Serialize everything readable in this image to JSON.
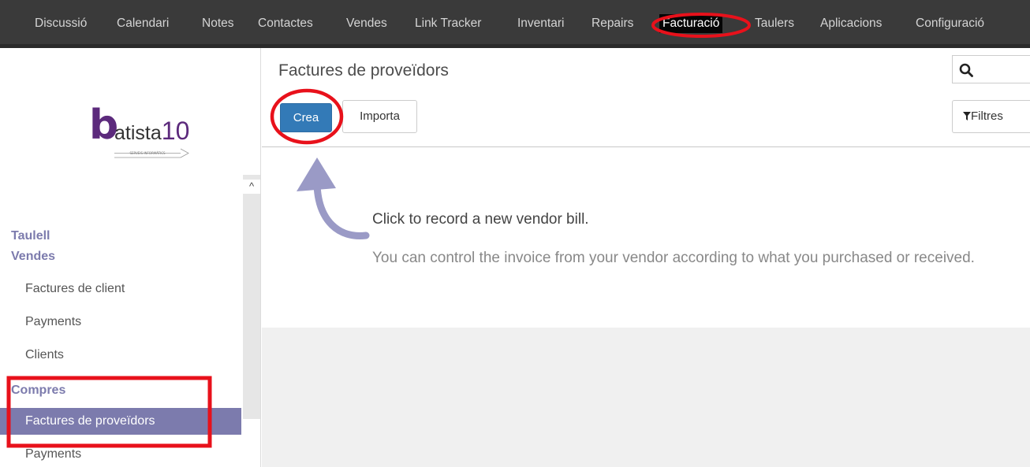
{
  "topbar": {
    "menu": [
      {
        "label": "Discussió"
      },
      {
        "label": "Calendari"
      },
      {
        "label": "Notes"
      },
      {
        "label": "Contactes"
      },
      {
        "label": "Vendes"
      },
      {
        "label": "Link Tracker"
      },
      {
        "label": "Inventari"
      },
      {
        "label": "Repairs"
      },
      {
        "label": "Facturació",
        "active": true
      },
      {
        "label": "Taulers"
      },
      {
        "label": "Aplicacions"
      },
      {
        "label": "Configuració"
      }
    ]
  },
  "logo": {
    "initial": "b",
    "name": "atista",
    "suffix": "10",
    "tagline": "SERVEIS INFORMÀTICS"
  },
  "sidebar": {
    "heading_dashboard": "Taulell",
    "heading_sales": "Vendes",
    "sales_items": [
      {
        "label": "Factures de client"
      },
      {
        "label": "Payments"
      },
      {
        "label": "Clients"
      }
    ],
    "heading_purchases": "Compres",
    "purchase_items": [
      {
        "label": "Factures de proveïdors",
        "active": true
      },
      {
        "label": "Payments"
      }
    ],
    "scroll_up": "^"
  },
  "main": {
    "title": "Factures de proveïdors",
    "create_button": "Crea",
    "import_button": "Importa",
    "filters_button": "Filtres",
    "help_title": "Click to record a new vendor bill.",
    "help_text": "You can control the invoice from your vendor according to what you purchased or received."
  },
  "colors": {
    "accent": "#7c7bad",
    "primary_button": "#337ab7",
    "topbar": "#3a3a3a",
    "annotation": "#e8111b"
  },
  "icons": {
    "search": "search-icon",
    "filter": "filter-icon"
  }
}
